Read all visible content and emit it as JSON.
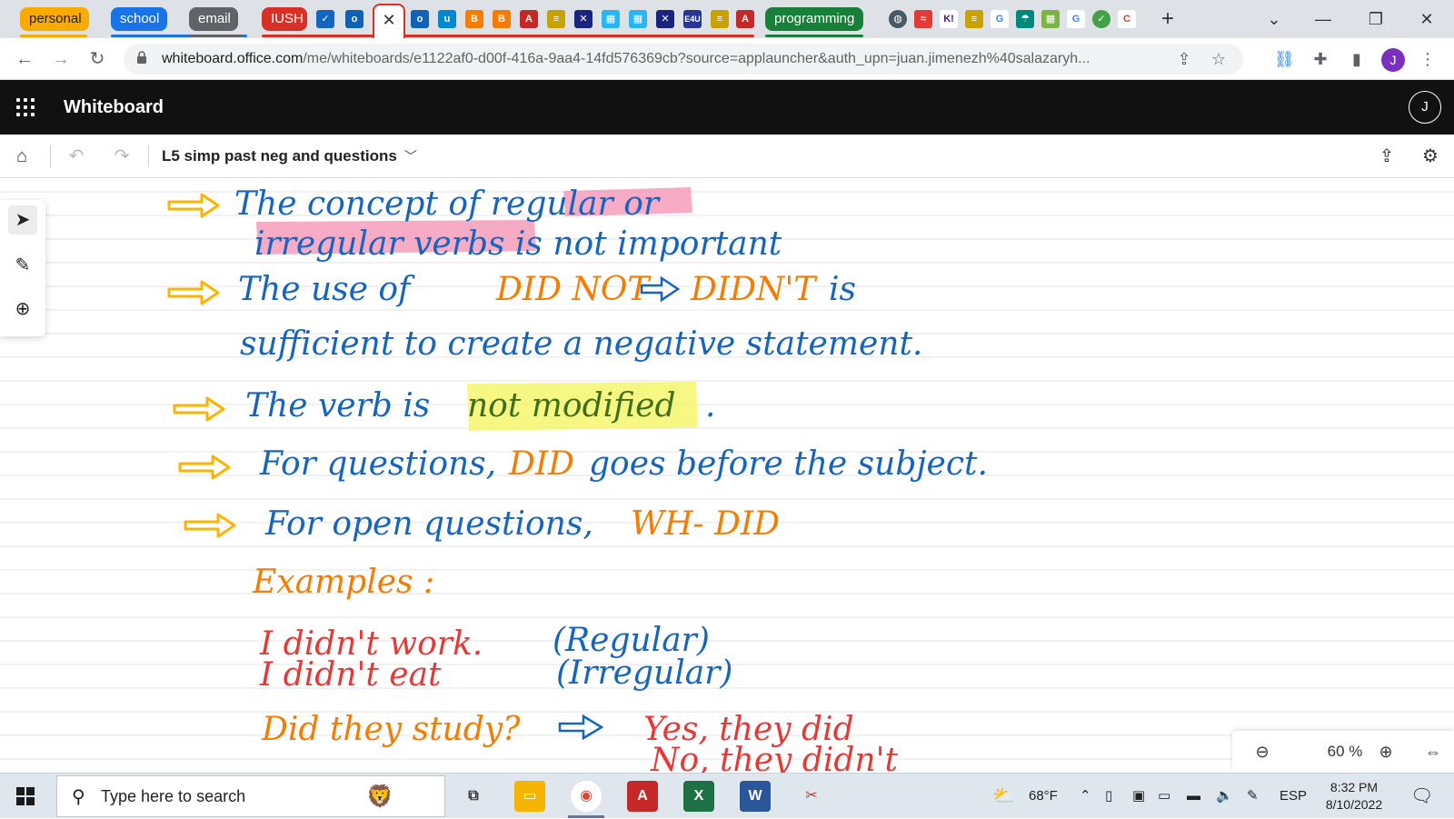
{
  "browser": {
    "tab_groups": [
      {
        "label": "personal",
        "color": "#f9ab00"
      },
      {
        "label": "school",
        "color": "#1a73e8"
      },
      {
        "label": "email",
        "color": "#5f6368"
      },
      {
        "label": "IUSH",
        "color": "#d93025"
      },
      {
        "label": "programming",
        "color": "#188038"
      }
    ],
    "active_tab_close": "✕",
    "new_tab": "+",
    "url_host": "whiteboard.office.com",
    "url_path": "/me/whiteboards/e1122af0-d00f-416a-9aa4-14fd576369cb?source=applauncher&auth_upn=juan.jimenezh%40salazaryh...",
    "profile_initial": "J"
  },
  "app": {
    "title": "Whiteboard",
    "user_initial": "J"
  },
  "board": {
    "name": "L5 simp past neg and questions",
    "zoom": "60 %"
  },
  "notes": {
    "line1a": "The concept of regular or",
    "line1b": "irregular verbs is not important",
    "line2a_blue1": "The use of",
    "line2a_orange": "DID NOT",
    "line2a_orange2": "DIDN'T",
    "line2a_blue2": "is",
    "line2b": "sufficient to create a negative statement.",
    "line3_blue1": "The verb is",
    "line3_hl": "not modified",
    "line3_end": ".",
    "line4_blue1": "For questions,",
    "line4_orange": "DID",
    "line4_blue2": "goes before the subject.",
    "line5_blue": "For open questions,",
    "line5_orange": "WH- DID",
    "examples": "Examples :",
    "ex1_left": "I didn't work.",
    "ex1_right": "(Regular)",
    "ex2_left": "I didn't eat",
    "ex2_right": "(Irregular)",
    "ex3_left": "Did they study?",
    "ex3_right": "Yes, they did",
    "ex4_right": "No, they didn't"
  },
  "taskbar": {
    "search_placeholder": "Type here to search",
    "weather": "68°F",
    "language": "ESP",
    "time": "8:32 PM",
    "date": "8/10/2022"
  },
  "colors": {
    "ink_blue": "#1565c0",
    "ink_orange": "#f57c00",
    "ink_red": "#e53935",
    "arrow_yellow": "#ffb300",
    "highlight_pink": "#f48fb1",
    "highlight_yellow": "#f4f45a"
  }
}
